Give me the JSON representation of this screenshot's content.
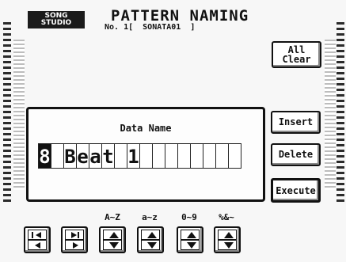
{
  "header": {
    "studio_label_line1": "SONG",
    "studio_label_line2": "STUDIO",
    "title": "PATTERN NAMING",
    "subtitle": "No. 1[  SONATA01  ]"
  },
  "right_buttons": {
    "all_clear_line1": "All",
    "all_clear_line2": "Clear",
    "insert": "Insert",
    "delete": "Delete",
    "execute": "Execute"
  },
  "data_panel": {
    "label": "Data Name",
    "chars": [
      "8",
      "",
      "B",
      "e",
      "a",
      "t",
      "",
      "1",
      "",
      "",
      "",
      "",
      "",
      "",
      "",
      ""
    ],
    "cursor_index": 0
  },
  "bottom": {
    "group_labels": [
      "A~Z",
      "a~z",
      "0~9",
      "%&~"
    ]
  },
  "colors": {
    "background": "#f7f7f7",
    "ink": "#111111",
    "cursor": "#111111"
  }
}
